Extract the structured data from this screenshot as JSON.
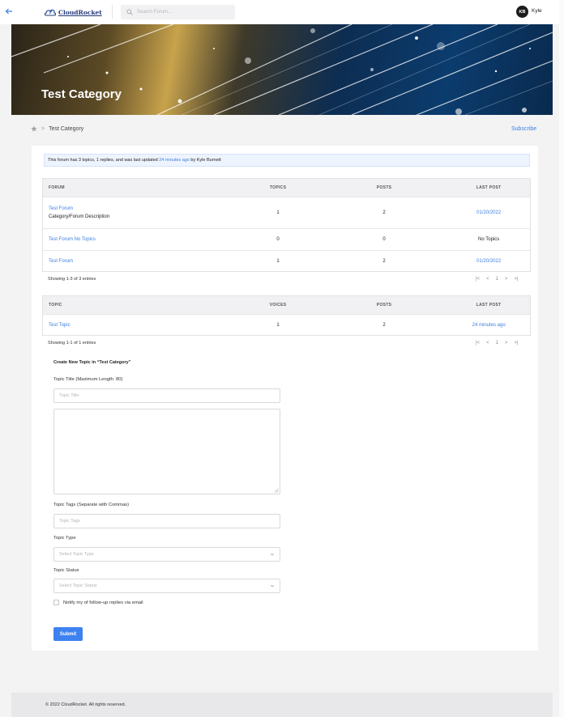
{
  "header": {
    "logo_text": "CloudRocket",
    "search_placeholder": "Search Forum...",
    "avatar_initials": "KB",
    "user_name": "Kyle"
  },
  "hero": {
    "title": "Test Category"
  },
  "breadcrumb": {
    "current": "Test Category",
    "subscribe_label": "Subscribe"
  },
  "info": {
    "prefix": "This forum has 3 topics, 1 replies, and was last updated ",
    "time_link": "24 minutes ago",
    "suffix": " by Kyle Burnett"
  },
  "forums_table": {
    "headers": [
      "FORUM",
      "TOPICS",
      "POSTS",
      "LAST POST"
    ],
    "rows": [
      {
        "name": "Test Forum",
        "description": "Category/Forum Description",
        "topics": "1",
        "posts": "2",
        "last_post": "01/20/2022",
        "last_post_link": true
      },
      {
        "name": "Test Forum No Topics",
        "description": "",
        "topics": "0",
        "posts": "0",
        "last_post": "No Topics",
        "last_post_link": false
      },
      {
        "name": "Test Forum",
        "description": "",
        "topics": "1",
        "posts": "2",
        "last_post": "01/20/2022",
        "last_post_link": true
      }
    ],
    "showing": "Showing 1-3 of 3 entries"
  },
  "topics_table": {
    "headers": [
      "TOPIC",
      "VOICES",
      "POSTS",
      "LAST POST"
    ],
    "rows": [
      {
        "name": "Test Topic",
        "voices": "1",
        "posts": "2",
        "last_post": "24 minutes ago"
      }
    ],
    "showing": "Showing 1-1 of 1 entries"
  },
  "pagination": {
    "first": "|<",
    "prev": "<",
    "page": "1",
    "next": ">",
    "last": ">|"
  },
  "form": {
    "title": "Create New Topic in “Test Category”",
    "title_label": "Topic Title (Maximum Length: 80)",
    "title_placeholder": "Topic Title",
    "tags_label": "Topic Tags (Separate with Commas)",
    "tags_placeholder": "Topic Tags",
    "type_label": "Topic Type",
    "type_placeholder": "Select Topic Type",
    "status_label": "Topic Status",
    "status_placeholder": "Select Topic Status",
    "notify_label": "Notify my of follow-up replies via email",
    "submit_label": "Submit"
  },
  "footer": {
    "text": "© 2022 CloudRocket. All rights reserved."
  }
}
